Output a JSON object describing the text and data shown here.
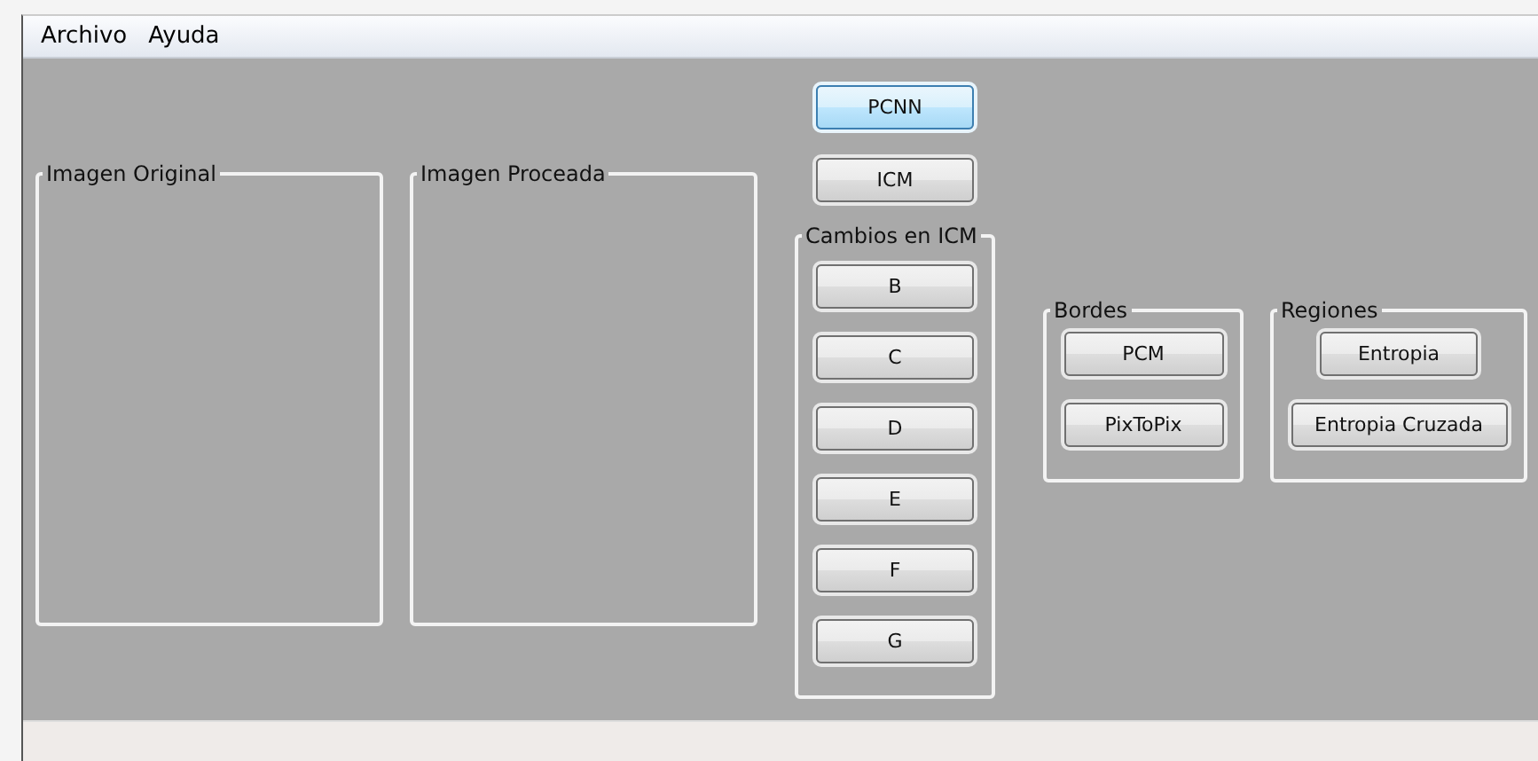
{
  "menu": [
    {
      "label": "Archivo"
    },
    {
      "label": "Ayuda"
    }
  ],
  "image_panels": [
    {
      "title": "Imagen Original"
    },
    {
      "title": "Imagen Proceada"
    }
  ],
  "buttons": [
    {
      "label": "PCNN",
      "focused": true
    },
    {
      "label": "ICM",
      "focused": false
    }
  ],
  "cambios": {
    "title": "Cambios en ICM",
    "buttons": [
      {
        "label": "B",
        "focused": false
      },
      {
        "label": "C",
        "focused": false
      },
      {
        "label": "D",
        "focused": false
      },
      {
        "label": "E",
        "focused": false
      },
      {
        "label": "F",
        "focused": false
      },
      {
        "label": "G",
        "focused": false
      }
    ]
  },
  "bordes": {
    "title": "Bordes",
    "buttons": [
      {
        "label": "PCM",
        "focused": false
      },
      {
        "label": "PixToPix",
        "focused": false
      }
    ]
  },
  "regiones": {
    "title": "Regiones",
    "buttons": [
      {
        "label": "Entropia",
        "focused": false
      },
      {
        "label": "Entropia Cruzada",
        "focused": false
      }
    ]
  }
}
